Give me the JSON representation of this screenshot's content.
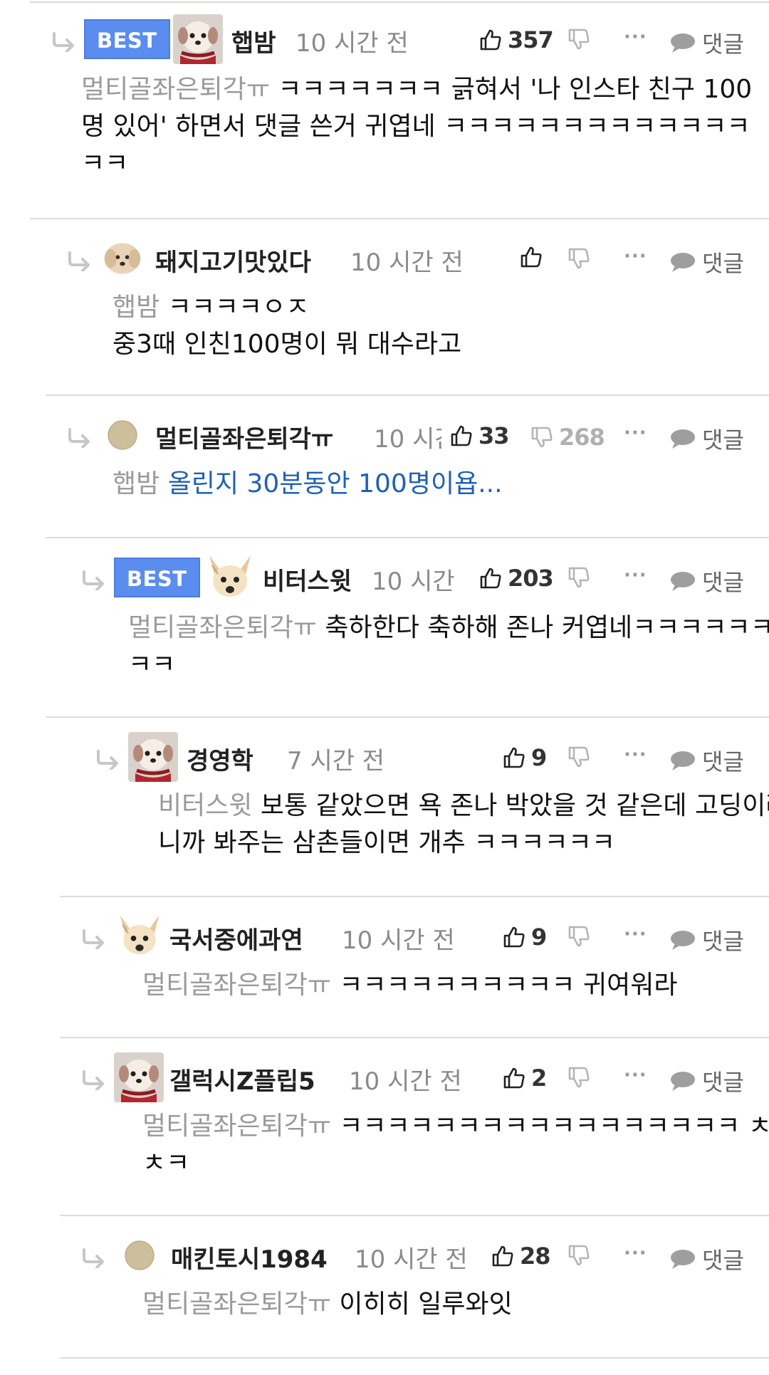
{
  "reply_button_label": "댓글",
  "more_label": "···",
  "best_label": "BEST",
  "comments": [
    {
      "username": "햅밤",
      "time": "10 시간 전",
      "best": true,
      "likes": "357",
      "dislikes": "",
      "mention": "멀티골좌은퇴각ㅠ",
      "text": " ㅋㅋㅋㅋㅋㅋㅋ 긁혀서 '나 인스타 친구 100명 있어' 하면서 댓글 쓴거 귀엽네 ㅋㅋㅋㅋㅋㅋㅋㅋㅋㅋㅋㅋㅋㅋㅋ",
      "avatar": "dog-red-scarf"
    },
    {
      "username": "돼지고기맛있다",
      "time": "10 시간 전",
      "best": false,
      "likes": "",
      "dislikes": "",
      "mention": "햅밤",
      "text": " ㅋㅋㅋㅋㅇㅈ\n중3때 인친100명이 뭐 대수라고",
      "avatar": "puppy-cream"
    },
    {
      "username": "멀티골좌은퇴각ㅠ",
      "time": "10 시간 전",
      "best": false,
      "likes": "33",
      "dislikes": "268",
      "mention": "햅밤",
      "text": "올린지 30분동안 100명이욥...",
      "text_is_link": true,
      "avatar": "beige-circle"
    },
    {
      "username": "비터스윗",
      "time": "10 시간 전",
      "best": true,
      "likes": "203",
      "dislikes": "",
      "mention": "멀티골좌은퇴각ㅠ",
      "text": " 축하한다 축하해 존나 커엽네ㅋㅋㅋㅋㅋㅋㅋㅋ",
      "avatar": "chihuahua"
    },
    {
      "username": "경영학",
      "time": "7 시간 전",
      "best": false,
      "likes": "9",
      "dislikes": "",
      "mention": "비터스윗",
      "text": " 보통 같았으면 욕 존나 박았을 것 같은데 고딩이라니까 봐주는 삼촌들이면 개추 ㅋㅋㅋㅋㅋㅋ",
      "avatar": "dog-red-scarf"
    },
    {
      "username": "국서중에과연",
      "time": "10 시간 전",
      "best": false,
      "likes": "9",
      "dislikes": "",
      "mention": "멀티골좌은퇴각ㅠ",
      "text": " ㅋㅋㅋㅋㅋㅋㅋㅋㅋㅋ 귀여워라",
      "avatar": "chihuahua"
    },
    {
      "username": "갤럭시Z플립5",
      "time": "10 시간 전",
      "best": false,
      "likes": "2",
      "dislikes": "",
      "mention": "멀티골좌은퇴각ㅠ",
      "text": " ㅋㅋㅋㅋㅋㅋㅋㅋㅋㅋㅋㅋㅋㅋㅋㅋㅋ ㅊㅋㅊㅋ",
      "avatar": "dog-red-scarf"
    },
    {
      "username": "매킨토시1984",
      "time": "10 시간 전",
      "best": false,
      "likes": "28",
      "dislikes": "",
      "mention": "멀티골좌은퇴각ㅠ",
      "text": " 이히히 일루와잇",
      "avatar": "beige-circle"
    }
  ]
}
